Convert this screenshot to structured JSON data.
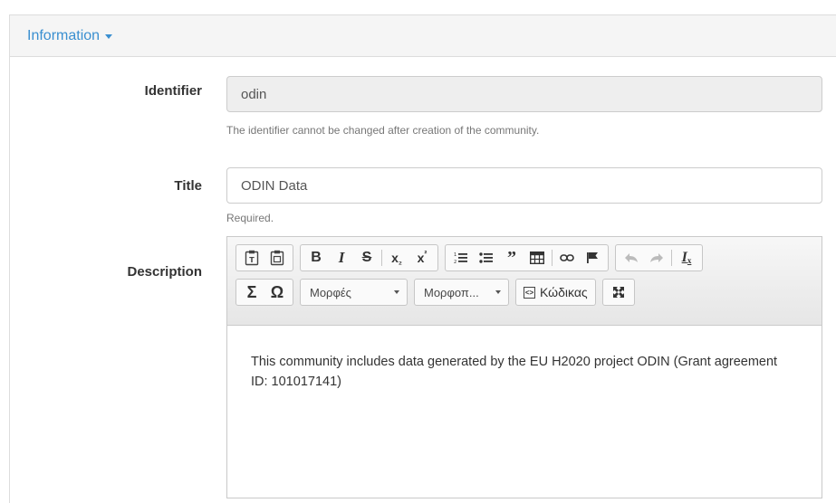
{
  "panel": {
    "heading": "Information"
  },
  "fields": {
    "identifier": {
      "label": "Identifier",
      "value": "odin",
      "help": "The identifier cannot be changed after creation of the community."
    },
    "title": {
      "label": "Title",
      "value": "ODIN Data",
      "help": "Required."
    },
    "description": {
      "label": "Description",
      "toolbar": {
        "format_styles_label": "Μορφές",
        "format_label": "Μορφοπ...",
        "source_label": "Κώδικας"
      },
      "content": "This community includes data generated by the EU H2020 project ODIN (Grant agreement ID: 101017141)"
    }
  },
  "icons": [
    "paste-text-icon",
    "paste-word-icon",
    "bold-icon",
    "italic-icon",
    "strikethrough-icon",
    "subscript-icon",
    "superscript-icon",
    "numbered-list-icon",
    "bulleted-list-icon",
    "blockquote-icon",
    "table-icon",
    "link-icon",
    "anchor-icon",
    "undo-icon",
    "redo-icon",
    "remove-format-icon",
    "math-icon",
    "special-char-icon",
    "source-icon",
    "maximize-icon"
  ]
}
